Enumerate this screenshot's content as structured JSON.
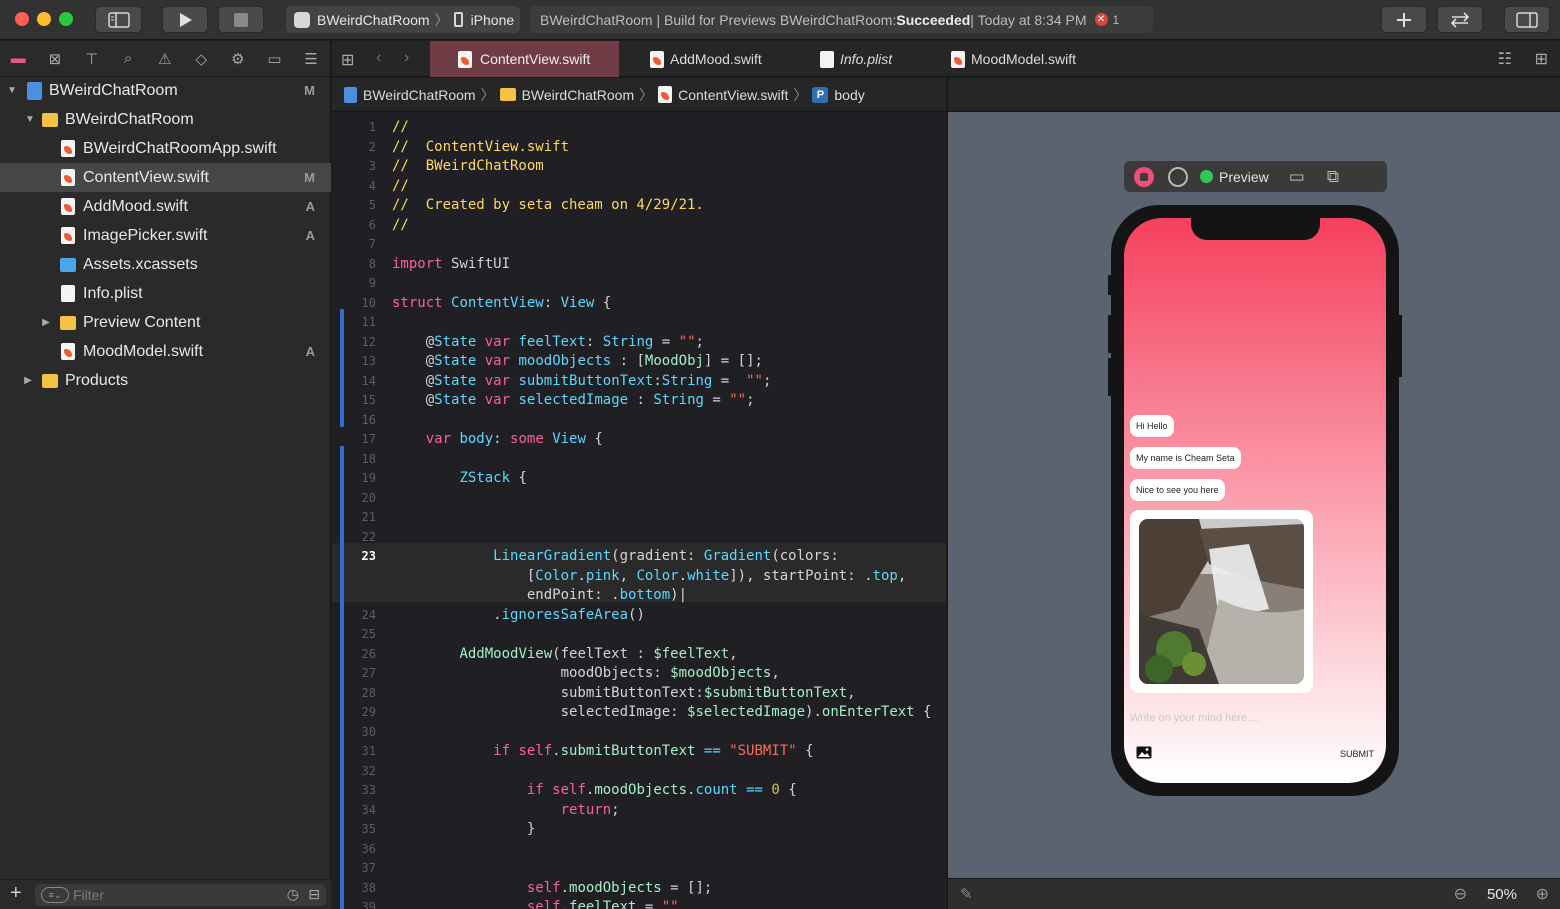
{
  "toolbar": {
    "scheme_target": "BWeirdChatRoom",
    "scheme_device": "iPhone",
    "status_prefix": "BWeirdChatRoom | Build for Previews BWeirdChatRoom: ",
    "status_result": "Succeeded",
    "status_time": " | Today at 8:34 PM",
    "error_count": "1",
    "colors": {
      "close": "#fe5f57",
      "minimize": "#febc2e",
      "zoom": "#28c840",
      "error": "#e0443e"
    }
  },
  "navigator": {
    "tree": [
      {
        "label": "BWeirdChatRoom",
        "icon": "project-icon",
        "status": "M",
        "depth": 0,
        "disclosure": "open"
      },
      {
        "label": "BWeirdChatRoom",
        "icon": "folder-icon",
        "status": "",
        "depth": 1,
        "disclosure": "open"
      },
      {
        "label": "BWeirdChatRoomApp.swift",
        "icon": "swift-file-icon",
        "status": "",
        "depth": 2,
        "disclosure": ""
      },
      {
        "label": "ContentView.swift",
        "icon": "swift-file-icon",
        "status": "M",
        "depth": 2,
        "disclosure": "",
        "selected": true
      },
      {
        "label": "AddMood.swift",
        "icon": "swift-file-icon",
        "status": "A",
        "depth": 2,
        "disclosure": ""
      },
      {
        "label": "ImagePicker.swift",
        "icon": "swift-file-icon",
        "status": "A",
        "depth": 2,
        "disclosure": ""
      },
      {
        "label": "Assets.xcassets",
        "icon": "assets-icon",
        "status": "",
        "depth": 2,
        "disclosure": ""
      },
      {
        "label": "Info.plist",
        "icon": "plist-icon",
        "status": "",
        "depth": 2,
        "disclosure": ""
      },
      {
        "label": "Preview Content",
        "icon": "folder-icon",
        "status": "",
        "depth": 2,
        "disclosure": "closed"
      },
      {
        "label": "MoodModel.swift",
        "icon": "swift-file-icon",
        "status": "A",
        "depth": 2,
        "disclosure": ""
      },
      {
        "label": "Products",
        "icon": "folder-icon",
        "status": "",
        "depth": 1,
        "disclosure": "closed"
      }
    ],
    "filter_placeholder": "Filter"
  },
  "tabs": [
    {
      "label": "ContentView.swift",
      "active": true,
      "italic": false
    },
    {
      "label": "AddMood.swift",
      "active": false,
      "italic": false
    },
    {
      "label": "Info.plist",
      "active": false,
      "italic": true
    },
    {
      "label": "MoodModel.swift",
      "active": false,
      "italic": false
    }
  ],
  "jumpbar": {
    "project": "BWeirdChatRoom",
    "folder": "BWeirdChatRoom",
    "file": "ContentView.swift",
    "symbol_badge": "P",
    "symbol": "body"
  },
  "editor": {
    "current_line": "23",
    "lines": [
      {
        "n": "1",
        "tokens": [
          [
            "c",
            "//"
          ]
        ]
      },
      {
        "n": "2",
        "tokens": [
          [
            "c",
            "//  ContentView.swift"
          ]
        ]
      },
      {
        "n": "3",
        "tokens": [
          [
            "c",
            "//  BWeirdChatRoom"
          ]
        ]
      },
      {
        "n": "4",
        "tokens": [
          [
            "c",
            "//"
          ]
        ]
      },
      {
        "n": "5",
        "tokens": [
          [
            "c",
            "//  Created by seta cheam on 4/29/21."
          ]
        ]
      },
      {
        "n": "6",
        "tokens": [
          [
            "c",
            "//"
          ]
        ]
      },
      {
        "n": "7",
        "tokens": []
      },
      {
        "n": "8",
        "tokens": [
          [
            "k",
            "import"
          ],
          [
            "p",
            " SwiftUI"
          ]
        ]
      },
      {
        "n": "9",
        "tokens": []
      },
      {
        "n": "10",
        "tokens": [
          [
            "k",
            "struct"
          ],
          [
            "p",
            " "
          ],
          [
            "t",
            "ContentView"
          ],
          [
            "p",
            ": "
          ],
          [
            "t",
            "View"
          ],
          [
            "p",
            " {"
          ]
        ]
      },
      {
        "n": "11",
        "tokens": []
      },
      {
        "n": "12",
        "tokens": [
          [
            "p",
            "    @"
          ],
          [
            "t",
            "State"
          ],
          [
            "p",
            " "
          ],
          [
            "k",
            "var"
          ],
          [
            "p",
            " "
          ],
          [
            "t",
            "feelText"
          ],
          [
            "p",
            ": "
          ],
          [
            "t",
            "String"
          ],
          [
            "p",
            " = "
          ],
          [
            "s",
            "\"\""
          ],
          [
            "p",
            ";"
          ]
        ]
      },
      {
        "n": "13",
        "tokens": [
          [
            "p",
            "    @"
          ],
          [
            "t",
            "State"
          ],
          [
            "p",
            " "
          ],
          [
            "k",
            "var"
          ],
          [
            "p",
            " "
          ],
          [
            "t",
            "moodObjects"
          ],
          [
            "p",
            " : ["
          ],
          [
            "g",
            "MoodObj"
          ],
          [
            "p",
            "] = [];"
          ]
        ]
      },
      {
        "n": "14",
        "tokens": [
          [
            "p",
            "    @"
          ],
          [
            "t",
            "State"
          ],
          [
            "p",
            " "
          ],
          [
            "k",
            "var"
          ],
          [
            "p",
            " "
          ],
          [
            "t",
            "submitButtonText"
          ],
          [
            "p",
            ":"
          ],
          [
            "t",
            "String"
          ],
          [
            "p",
            " =  "
          ],
          [
            "s",
            "\"\""
          ],
          [
            "p",
            ";"
          ]
        ]
      },
      {
        "n": "15",
        "tokens": [
          [
            "p",
            "    @"
          ],
          [
            "t",
            "State"
          ],
          [
            "p",
            " "
          ],
          [
            "k",
            "var"
          ],
          [
            "p",
            " "
          ],
          [
            "t",
            "selectedImage"
          ],
          [
            "p",
            " : "
          ],
          [
            "t",
            "String"
          ],
          [
            "p",
            " = "
          ],
          [
            "s",
            "\"\""
          ],
          [
            "p",
            ";"
          ]
        ]
      },
      {
        "n": "16",
        "tokens": []
      },
      {
        "n": "17",
        "tokens": [
          [
            "p",
            "    "
          ],
          [
            "k",
            "var"
          ],
          [
            "p",
            " "
          ],
          [
            "t",
            "body"
          ],
          [
            "p",
            ": "
          ],
          [
            "k",
            "some"
          ],
          [
            "p",
            " "
          ],
          [
            "t",
            "View"
          ],
          [
            "p",
            " {"
          ]
        ]
      },
      {
        "n": "18",
        "tokens": []
      },
      {
        "n": "19",
        "tokens": [
          [
            "p",
            "        "
          ],
          [
            "t",
            "ZStack"
          ],
          [
            "p",
            " {"
          ]
        ]
      },
      {
        "n": "20",
        "tokens": []
      },
      {
        "n": "21",
        "tokens": []
      },
      {
        "n": "22",
        "tokens": []
      },
      {
        "n": "23",
        "tokens": [
          [
            "p",
            "            "
          ],
          [
            "t",
            "LinearGradient"
          ],
          [
            "p",
            "(gradient: "
          ],
          [
            "t",
            "Gradient"
          ],
          [
            "p",
            "(colors:"
          ]
        ]
      },
      {
        "n": "",
        "tokens": [
          [
            "p",
            "                ["
          ],
          [
            "t",
            "Color"
          ],
          [
            "p",
            "."
          ],
          [
            "t",
            "pink"
          ],
          [
            "p",
            ", "
          ],
          [
            "t",
            "Color"
          ],
          [
            "p",
            "."
          ],
          [
            "t",
            "white"
          ],
          [
            "p",
            "]), startPoint: ."
          ],
          [
            "t",
            "top"
          ],
          [
            "p",
            ","
          ]
        ]
      },
      {
        "n": "",
        "tokens": [
          [
            "p",
            "                endPoint: ."
          ],
          [
            "t",
            "bottom"
          ],
          [
            "p",
            ")|"
          ]
        ]
      },
      {
        "n": "24",
        "tokens": [
          [
            "p",
            "            ."
          ],
          [
            "t",
            "ignoresSafeArea"
          ],
          [
            "p",
            "()"
          ]
        ]
      },
      {
        "n": "25",
        "tokens": []
      },
      {
        "n": "26",
        "tokens": [
          [
            "p",
            "        "
          ],
          [
            "g",
            "AddMoodView"
          ],
          [
            "p",
            "(feelText : "
          ],
          [
            "g",
            "$feelText"
          ],
          [
            "p",
            ","
          ]
        ]
      },
      {
        "n": "27",
        "tokens": [
          [
            "p",
            "                    moodObjects: "
          ],
          [
            "g",
            "$moodObjects"
          ],
          [
            "p",
            ","
          ]
        ]
      },
      {
        "n": "28",
        "tokens": [
          [
            "p",
            "                    submitButtonText:"
          ],
          [
            "g",
            "$submitButtonText"
          ],
          [
            "p",
            ","
          ]
        ]
      },
      {
        "n": "29",
        "tokens": [
          [
            "p",
            "                    selectedImage: "
          ],
          [
            "g",
            "$selectedImage"
          ],
          [
            "p",
            ")."
          ],
          [
            "g",
            "onEnterText"
          ],
          [
            "p",
            " {"
          ]
        ]
      },
      {
        "n": "30",
        "tokens": []
      },
      {
        "n": "31",
        "tokens": [
          [
            "p",
            "            "
          ],
          [
            "k",
            "if"
          ],
          [
            "p",
            " "
          ],
          [
            "k",
            "self"
          ],
          [
            "p",
            "."
          ],
          [
            "g",
            "submitButtonText"
          ],
          [
            "p",
            " "
          ],
          [
            "t",
            "=="
          ],
          [
            "p",
            " "
          ],
          [
            "s",
            "\"SUBMIT\""
          ],
          [
            "p",
            " {"
          ]
        ]
      },
      {
        "n": "32",
        "tokens": []
      },
      {
        "n": "33",
        "tokens": [
          [
            "p",
            "                "
          ],
          [
            "k",
            "if"
          ],
          [
            "p",
            " "
          ],
          [
            "k",
            "self"
          ],
          [
            "p",
            "."
          ],
          [
            "g",
            "moodObjects"
          ],
          [
            "p",
            "."
          ],
          [
            "t",
            "count"
          ],
          [
            "p",
            " "
          ],
          [
            "t",
            "=="
          ],
          [
            "p",
            " "
          ],
          [
            "n",
            "0"
          ],
          [
            "p",
            " {"
          ]
        ]
      },
      {
        "n": "34",
        "tokens": [
          [
            "p",
            "                    "
          ],
          [
            "k",
            "return"
          ],
          [
            "p",
            ";"
          ]
        ]
      },
      {
        "n": "35",
        "tokens": [
          [
            "p",
            "                }"
          ]
        ]
      },
      {
        "n": "36",
        "tokens": []
      },
      {
        "n": "37",
        "tokens": []
      },
      {
        "n": "38",
        "tokens": [
          [
            "p",
            "                "
          ],
          [
            "k",
            "self"
          ],
          [
            "p",
            "."
          ],
          [
            "g",
            "moodObjects"
          ],
          [
            "p",
            " = [];"
          ]
        ]
      },
      {
        "n": "39",
        "tokens": [
          [
            "p",
            "                "
          ],
          [
            "k",
            "self"
          ],
          [
            "p",
            "."
          ],
          [
            "g",
            "feelText"
          ],
          [
            "p",
            " = "
          ],
          [
            "s",
            "\"\""
          ]
        ]
      }
    ]
  },
  "preview": {
    "label": "Preview",
    "messages": [
      "Hi Hello",
      "My name is Cheam Seta",
      "Nice to see you here"
    ],
    "input_placeholder": "Write on your mind here....",
    "submit_label": "SUBMIT",
    "zoom": "50%",
    "gradient_colors": [
      "#f6405d",
      "#ffffff"
    ]
  }
}
